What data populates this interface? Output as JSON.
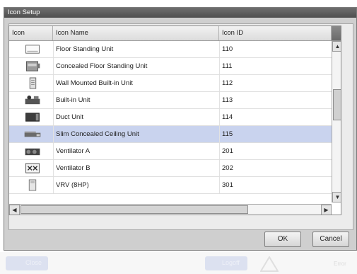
{
  "window": {
    "title": "Icon Setup"
  },
  "table": {
    "columns": [
      "Icon",
      "Icon Name",
      "Icon ID"
    ],
    "rows": [
      {
        "icon": "floor-standing-unit-icon",
        "name": "Floor Standing Unit",
        "id": "110",
        "selected": false
      },
      {
        "icon": "concealed-floor-standing-unit-icon",
        "name": "Concealed Floor Standing Unit",
        "id": "111",
        "selected": false
      },
      {
        "icon": "wall-mounted-built-in-unit-icon",
        "name": "Wall Mounted Built-in Unit",
        "id": "112",
        "selected": false
      },
      {
        "icon": "built-in-unit-icon",
        "name": "Built-in Unit",
        "id": "113",
        "selected": false
      },
      {
        "icon": "duct-unit-icon",
        "name": "Duct Unit",
        "id": "114",
        "selected": false
      },
      {
        "icon": "slim-concealed-ceiling-unit-icon",
        "name": "Slim Concealed Ceiling Unit",
        "id": "115",
        "selected": true
      },
      {
        "icon": "ventilator-a-icon",
        "name": "Ventilator A",
        "id": "201",
        "selected": false
      },
      {
        "icon": "ventilator-b-icon",
        "name": "Ventilator B",
        "id": "202",
        "selected": false
      },
      {
        "icon": "vrv-8hp-icon",
        "name": "VRV (8HP)",
        "id": "301",
        "selected": false
      }
    ],
    "selected_row_color": "#c9d3ee"
  },
  "buttons": {
    "ok": "OK",
    "cancel": "Cancel"
  },
  "background_bar": {
    "close": "Close",
    "logoff": "Logoff",
    "status": "Error"
  }
}
